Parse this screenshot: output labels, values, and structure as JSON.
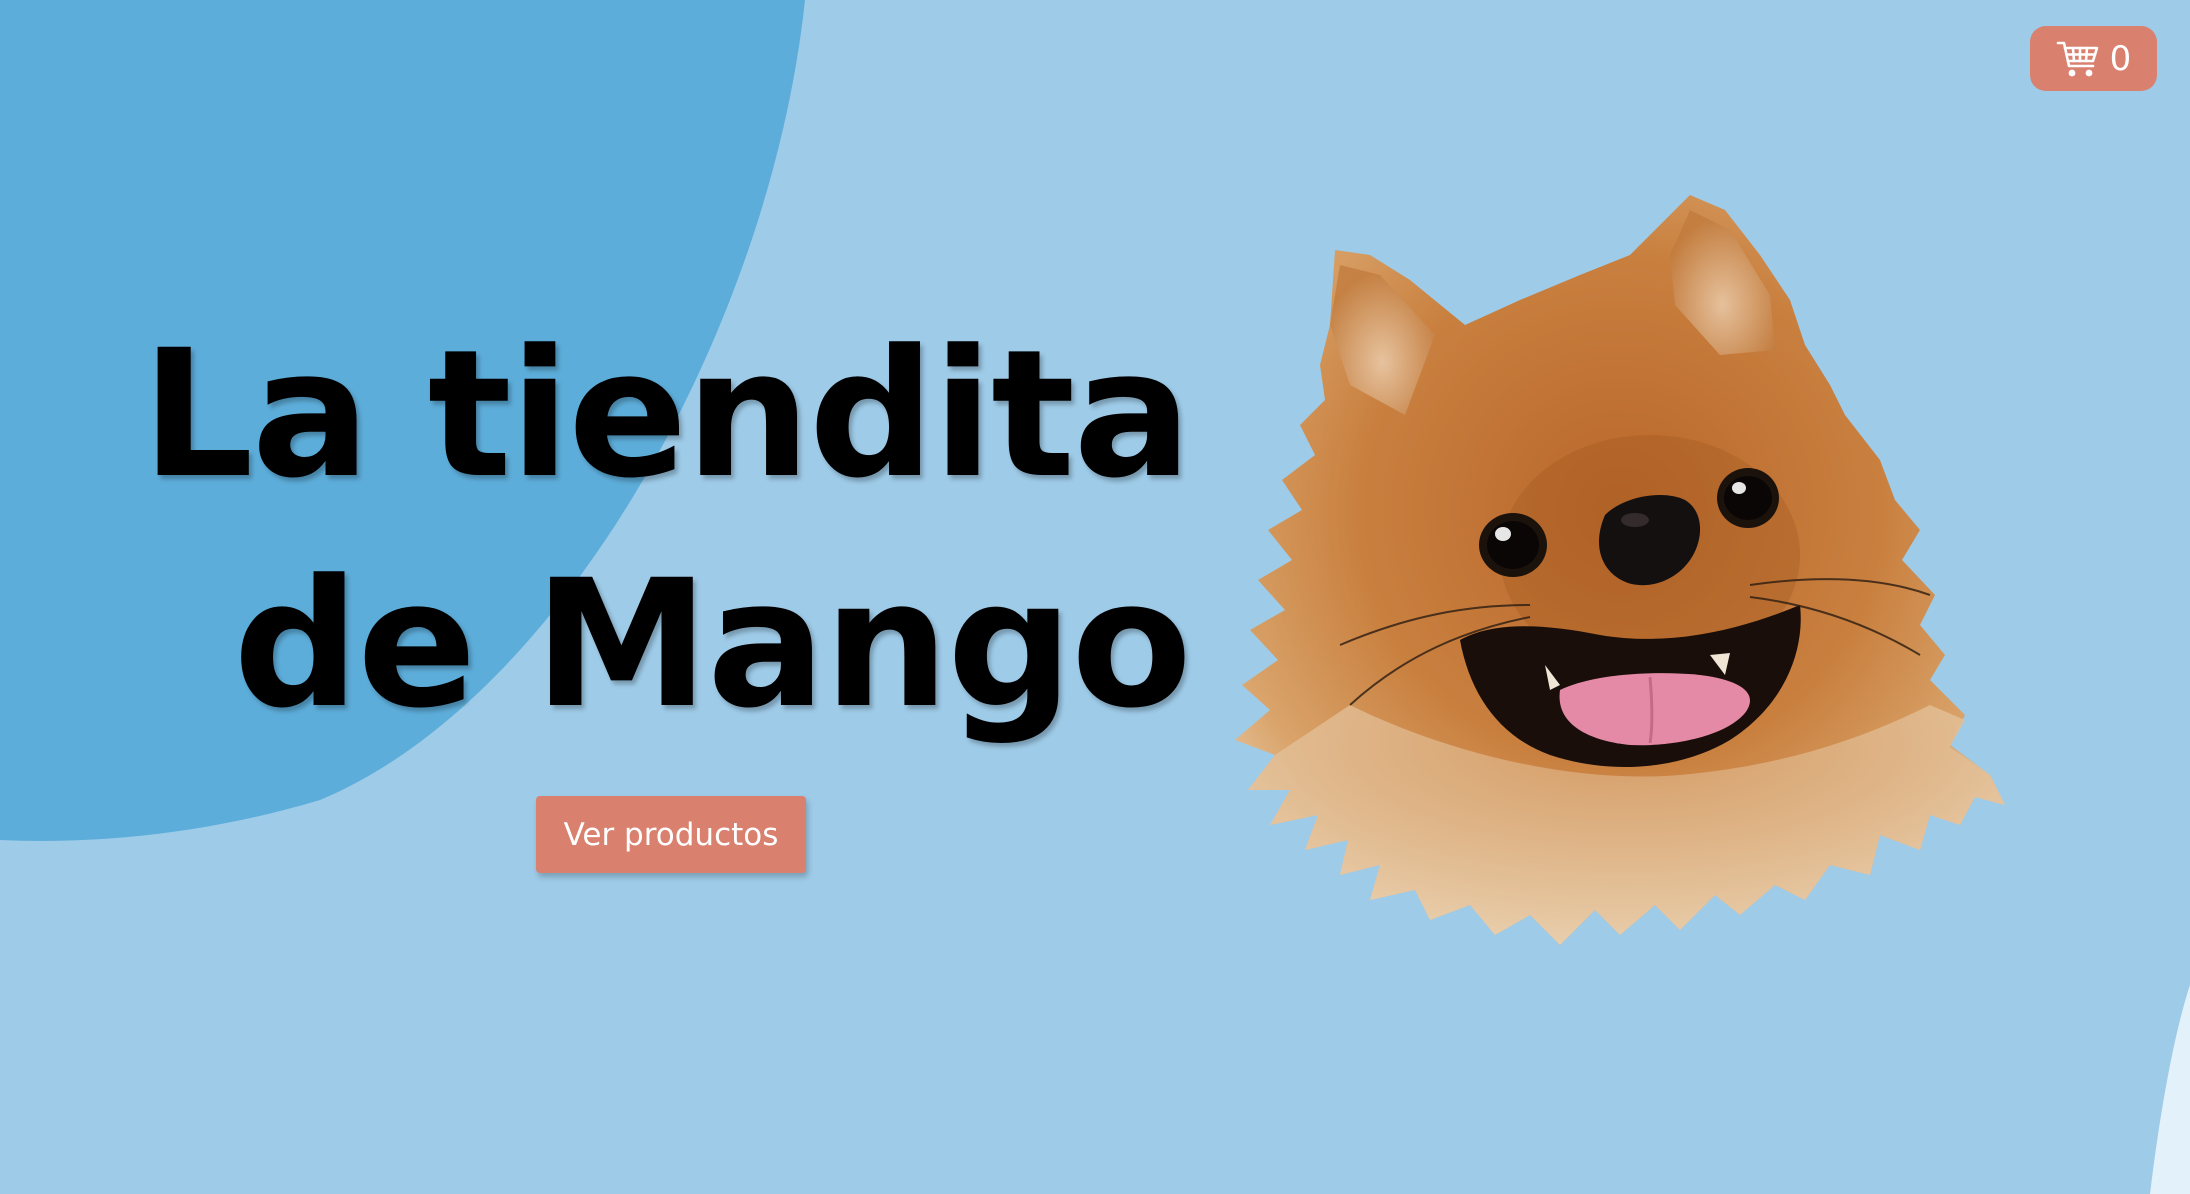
{
  "header": {
    "cart": {
      "icon": "shopping-cart-icon",
      "count": "0"
    }
  },
  "hero": {
    "title_line_1": "La tiendita",
    "title_line_2": "de Mango",
    "cta_label": "Ver productos",
    "image_subject": "pomeranian-dog-head"
  },
  "colors": {
    "background": "#9ecbe8",
    "blob": "#5dadda",
    "accent": "#d9806e",
    "title": "#000000",
    "button_text": "#ffffff"
  }
}
